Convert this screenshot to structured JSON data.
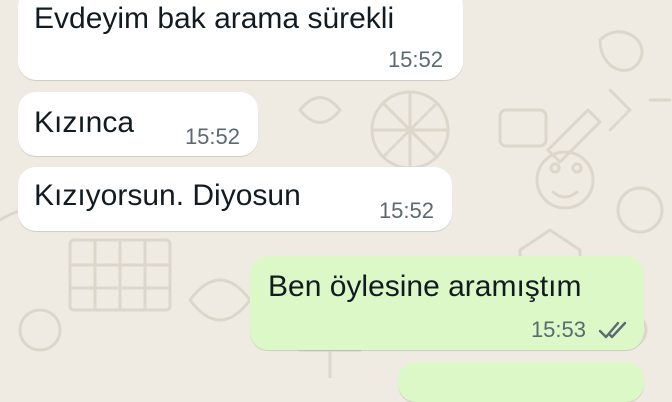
{
  "chat": {
    "messages": [
      {
        "direction": "incoming",
        "text": "Evdeyim bak arama sürekli",
        "time": "15:52"
      },
      {
        "direction": "incoming",
        "text": "Kızınca",
        "time": "15:52"
      },
      {
        "direction": "incoming",
        "text": "Kızıyorsun. Diyosun",
        "time": "15:52"
      },
      {
        "direction": "outgoing",
        "text": "Ben öylesine aramıştım",
        "time": "15:53",
        "status": "read"
      }
    ]
  },
  "theme": {
    "chat_background": "#efeae2",
    "incoming_bubble": "#ffffff",
    "outgoing_bubble": "#dcf8c6",
    "read_ticks": "#5b6a71"
  },
  "icons": {
    "read_status": "double-check-icon",
    "wallpaper": "doodle-wallpaper"
  }
}
